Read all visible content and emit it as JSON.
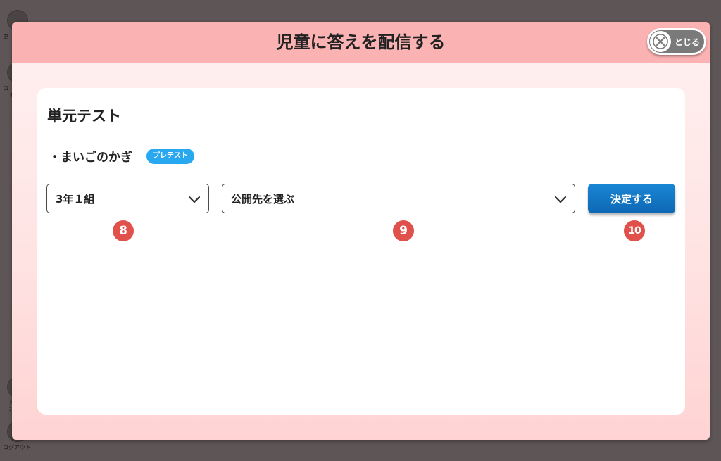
{
  "background": {
    "sidebar_labels": [
      "単",
      "コ",
      "セ",
      "ト",
      "ン",
      "ログアウト"
    ]
  },
  "modal": {
    "title": "児童に答えを配信する",
    "close_label": "とじる"
  },
  "card": {
    "title": "単元テスト",
    "item_name": "・まいごのかぎ",
    "badge": "プレテスト"
  },
  "controls": {
    "class_select_value": "3年１組",
    "target_select_placeholder": "公開先を選ぶ",
    "decide_label": "決定する"
  },
  "markers": [
    "8",
    "9",
    "10"
  ],
  "colors": {
    "header": "#fbb2b2",
    "accent_blue": "#0d68b4",
    "badge_blue": "#29a8f2",
    "marker_red": "#e0514c"
  }
}
